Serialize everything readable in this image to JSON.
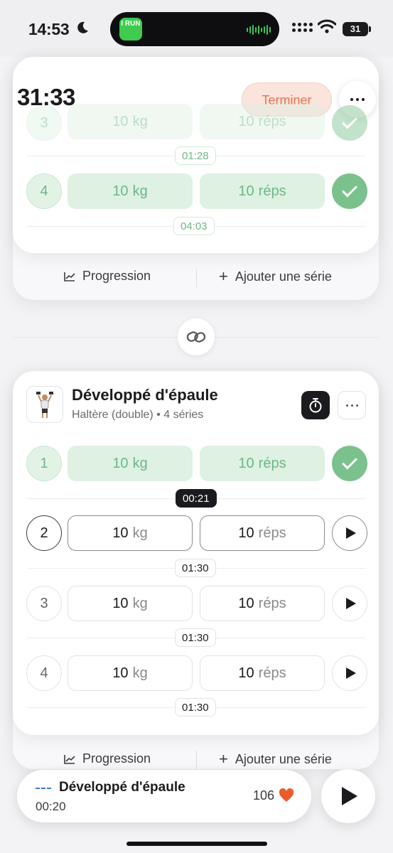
{
  "status_bar": {
    "time": "14:53",
    "battery": "31",
    "island_app_label": "I RUN"
  },
  "workout": {
    "elapsed": "31:33",
    "finish_label": "Terminer"
  },
  "top_exercise": {
    "sets": [
      {
        "number": "3",
        "weight": "10",
        "weight_unit": "kg",
        "reps": "10",
        "reps_unit": "réps"
      },
      {
        "number": "4",
        "weight": "10",
        "weight_unit": "kg",
        "reps": "10",
        "reps_unit": "réps"
      }
    ],
    "rests": [
      "01:28",
      "04:03"
    ],
    "footer": {
      "progress_label": "Progression",
      "add_set_label": "Ajouter une série"
    }
  },
  "exercise": {
    "title": "Développé d'épaule",
    "equipment": "Haltère (double)",
    "separator": "•",
    "set_count": "4 séries",
    "sets": [
      {
        "number": "1",
        "weight": "10",
        "weight_unit": "kg",
        "reps": "10",
        "reps_unit": "réps",
        "status": "done"
      },
      {
        "number": "2",
        "weight": "10",
        "weight_unit": "kg",
        "reps": "10",
        "reps_unit": "réps",
        "status": "active"
      },
      {
        "number": "3",
        "weight": "10",
        "weight_unit": "kg",
        "reps": "10",
        "reps_unit": "réps",
        "status": "pending"
      },
      {
        "number": "4",
        "weight": "10",
        "weight_unit": "kg",
        "reps": "10",
        "reps_unit": "réps",
        "status": "pending"
      }
    ],
    "rests": [
      "00:21",
      "01:30",
      "01:30",
      "01:30"
    ],
    "footer": {
      "progress_label": "Progression",
      "add_set_label": "Ajouter une série"
    }
  },
  "player": {
    "title": "Développé d'épaule",
    "time": "00:20",
    "heart_rate": "106"
  },
  "colors": {
    "done_green": "#7bc18d",
    "finish_orange": "#df7350",
    "heart": "#ea5b2c"
  },
  "icons": [
    "moon-icon",
    "wifi-icon",
    "chart-icon",
    "plus-icon",
    "link-icon",
    "stopwatch-icon",
    "more-icon",
    "check-icon",
    "play-icon",
    "heart-icon"
  ]
}
